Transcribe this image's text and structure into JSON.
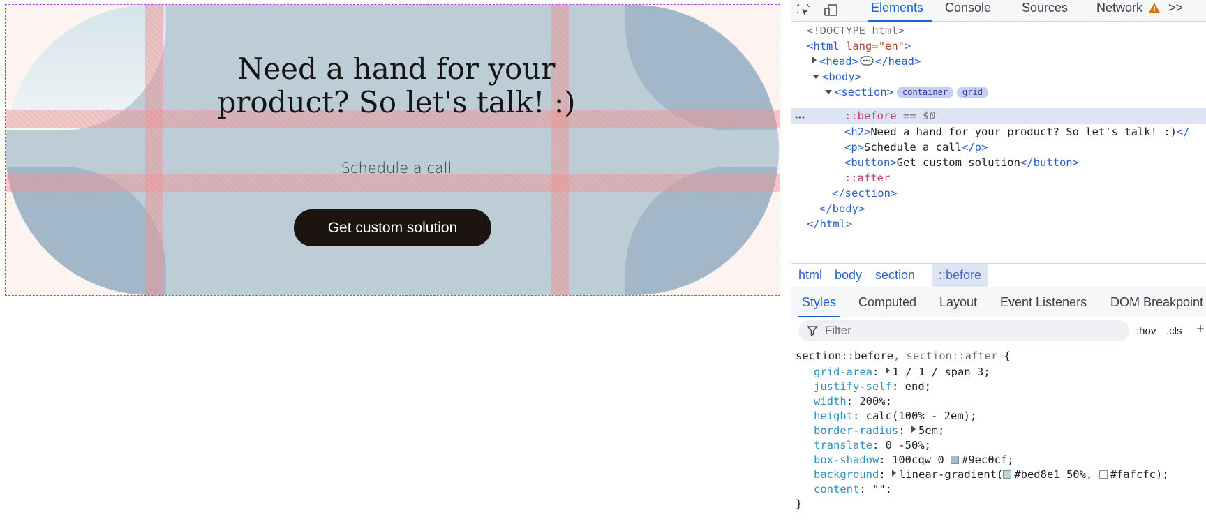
{
  "preview": {
    "title_line1": "Need a hand for your",
    "title_line2": "product? So let's talk! :)",
    "subtitle": "Schedule a call",
    "button_label": "Get custom solution"
  },
  "devtools": {
    "tabs": [
      "Elements",
      "Console",
      "Sources",
      "Network"
    ],
    "more_tabs": ">>",
    "dom": {
      "doctype": "<!DOCTYPE html>",
      "html_open_tag": "<html",
      "lang_attr": "lang",
      "lang_eq": "=",
      "lang_value": "\"en\"",
      "html_close_bracket": ">",
      "head_open": "<head>",
      "head_close": "</head>",
      "body_open": "<body>",
      "section_open": "<section>",
      "badge_container": "container",
      "badge_grid": "grid",
      "before": "::before",
      "selected_marker": "== $0",
      "h2_open": "<h2>",
      "h2_text": "Need a hand for your product? So let's talk! :)",
      "h2_close": "</",
      "p_open": "<p>",
      "p_text": "Schedule a call",
      "p_close": "</p>",
      "button_open": "<button>",
      "button_text": "Get custom solution",
      "button_close": "</button>",
      "after": "::after",
      "section_close": "</section>",
      "body_close": "</body>",
      "html_close": "</html>"
    },
    "breadcrumb": [
      "html",
      "body",
      "section",
      "::before"
    ],
    "subtabs": [
      "Styles",
      "Computed",
      "Layout",
      "Event Listeners",
      "DOM Breakpoint"
    ],
    "filter_placeholder": "Filter",
    "hov": ":hov",
    "cls": ".cls",
    "plus": "+",
    "rule": {
      "selector": "section::before",
      "selector_sep": ", ",
      "selector2": "section::after",
      "open_brace": " {",
      "close_brace": "}",
      "props": [
        {
          "name": "grid-area",
          "value": "1 / 1 / span 3;",
          "expandable": true
        },
        {
          "name": "justify-self",
          "value": "end;"
        },
        {
          "name": "width",
          "value": "200%;"
        },
        {
          "name": "height",
          "value": "calc(100% - 2em);"
        },
        {
          "name": "border-radius",
          "value": "5em;",
          "expandable": true
        },
        {
          "name": "translate",
          "value": "0 -50%;"
        },
        {
          "name": "box-shadow",
          "value_prefix": "100cqw 0 ",
          "swatch": "#9ec0cf",
          "value": "#9ec0cf;"
        },
        {
          "name": "background",
          "value_prefix": "linear-gradient(",
          "swatch": "#bed8e1",
          "value": "#bed8e1 50%,",
          "swatch2": "#fafcfc",
          "value2": "#fafcfc);",
          "expandable": true
        },
        {
          "name": "content",
          "value": "\"\";"
        }
      ]
    }
  }
}
